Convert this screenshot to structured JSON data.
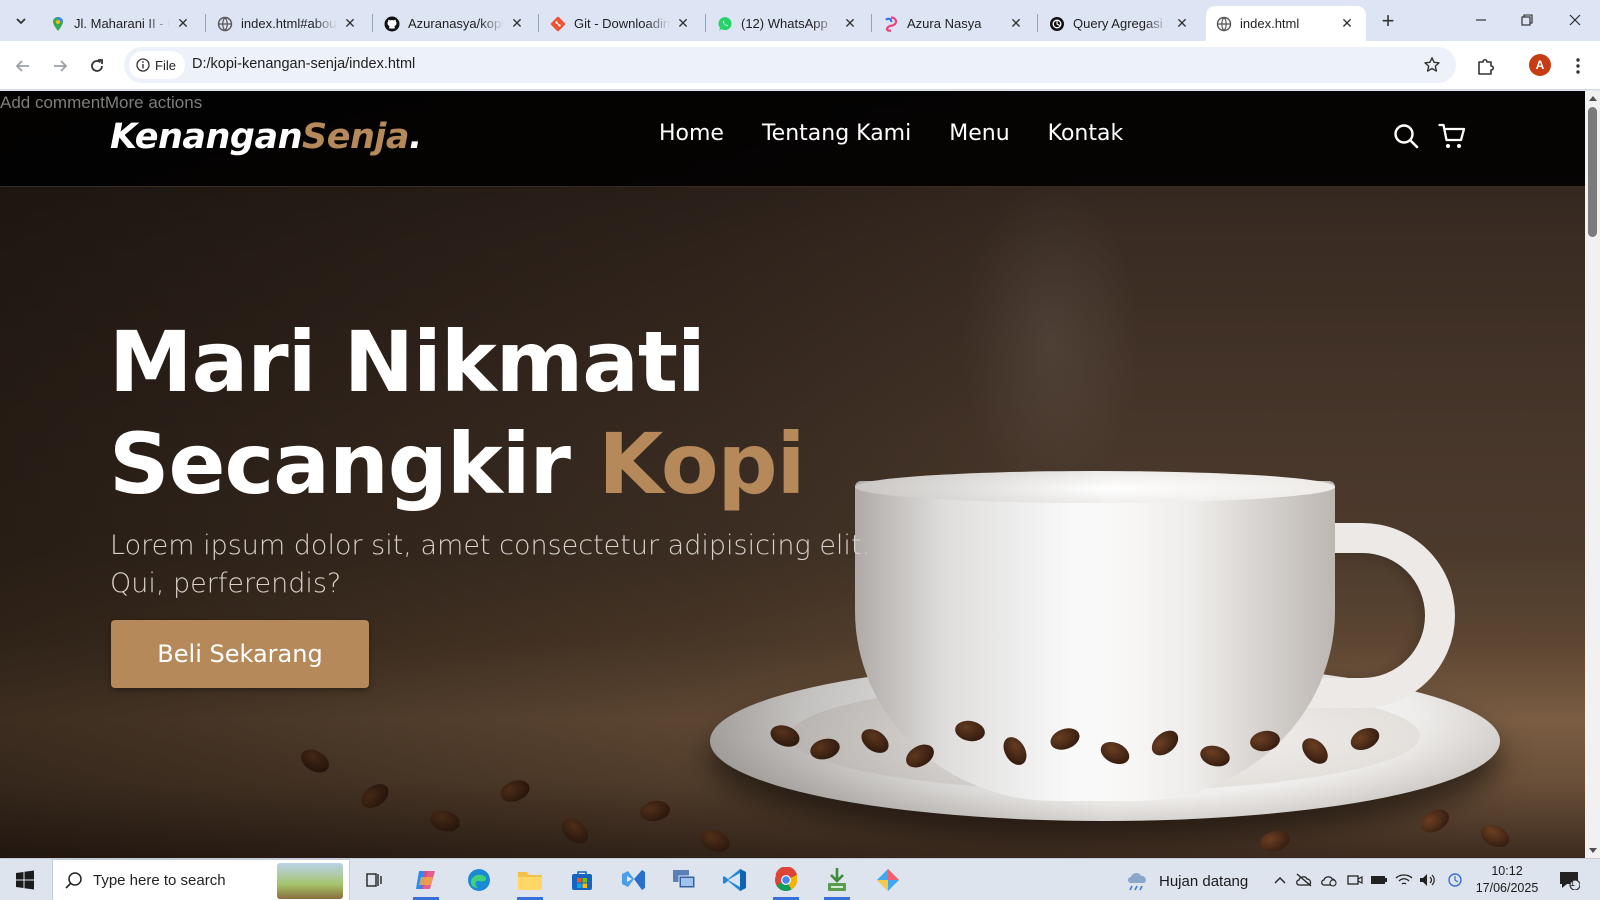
{
  "browser": {
    "tabs": [
      {
        "title": "Jl. Maharani II - G",
        "icon": "maps-pin-icon"
      },
      {
        "title": "index.html#about",
        "icon": "globe-icon"
      },
      {
        "title": "Azuranasya/kopi",
        "icon": "github-icon"
      },
      {
        "title": "Git - Downloading",
        "icon": "git-icon"
      },
      {
        "title": "(12) WhatsApp",
        "icon": "whatsapp-icon"
      },
      {
        "title": "Azura Nasya",
        "icon": "swirl-icon"
      },
      {
        "title": "Query Agregasi S",
        "icon": "openai-icon"
      },
      {
        "title": "index.html",
        "icon": "globe-icon",
        "active": true
      }
    ],
    "chip_label": "File",
    "url": "D:/kopi-kenangan-senja/index.html",
    "profile_initial": "A",
    "colors": {
      "profile": "#c73c12",
      "tabstrip": "#dde5f4"
    }
  },
  "page": {
    "overlay_text": "Add commentMore actions",
    "logo": {
      "main": "Kenangan",
      "accent": "Senja",
      "dot": "."
    },
    "nav": [
      "Home",
      "Tentang Kami",
      "Menu",
      "Kontak"
    ],
    "nav_icons": [
      "search-icon",
      "cart-icon"
    ],
    "hero": {
      "line1": "Mari Nikmati",
      "line2_main": "Secangkir ",
      "line2_accent": "Kopi",
      "subtext": "Lorem ipsum dolor sit, amet consectetur adipisicing elit. Qui, perferendis?",
      "cta": "Beli Sekarang"
    },
    "colors": {
      "accent": "#b6895b",
      "nav_bg": "#000000"
    }
  },
  "taskbar": {
    "search_placeholder": "Type here to search",
    "apps": [
      "task-view-icon",
      "copilot-icon",
      "edge-icon",
      "file-explorer-icon",
      "store-icon",
      "visual-studio-icon",
      "remote-desktop-icon",
      "vscode-icon",
      "chrome-icon",
      "git-installer-icon",
      "app-icon"
    ],
    "weather": "Hujan datang",
    "time": "10:12",
    "date": "17/06/2025",
    "notification_count": "1"
  }
}
